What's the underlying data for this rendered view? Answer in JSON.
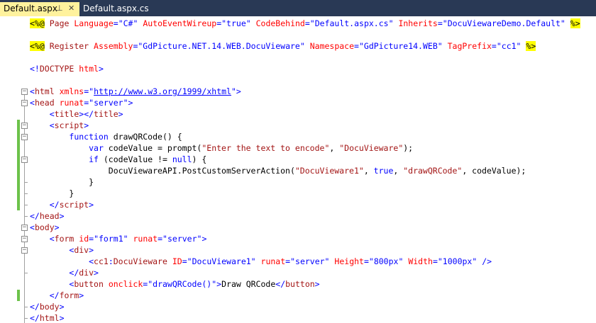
{
  "tabs": [
    {
      "label": "Default.aspx",
      "active": true,
      "pin_icon": "pin-icon",
      "close_icon": "close-icon"
    },
    {
      "label": "Default.aspx.cs",
      "active": false
    }
  ],
  "code_lines": [
    [
      [
        "dir",
        "<%@"
      ],
      [
        "black",
        " "
      ],
      [
        "maroon",
        "Page"
      ],
      [
        "black",
        " "
      ],
      [
        "red",
        "Language"
      ],
      [
        "blue",
        "="
      ],
      [
        "str",
        "\"C#\""
      ],
      [
        "black",
        " "
      ],
      [
        "red",
        "AutoEventWireup"
      ],
      [
        "blue",
        "="
      ],
      [
        "str",
        "\"true\""
      ],
      [
        "black",
        " "
      ],
      [
        "red",
        "CodeBehind"
      ],
      [
        "blue",
        "="
      ],
      [
        "str",
        "\"Default.aspx.cs\""
      ],
      [
        "black",
        " "
      ],
      [
        "red",
        "Inherits"
      ],
      [
        "blue",
        "="
      ],
      [
        "str",
        "\"DocuViewareDemo.Default\""
      ],
      [
        "black",
        " "
      ],
      [
        "dir",
        "%>"
      ]
    ],
    [],
    [
      [
        "dir",
        "<%@"
      ],
      [
        "black",
        " "
      ],
      [
        "maroon",
        "Register"
      ],
      [
        "black",
        " "
      ],
      [
        "red",
        "Assembly"
      ],
      [
        "blue",
        "="
      ],
      [
        "str",
        "\"GdPicture.NET.14.WEB.DocuVieware\""
      ],
      [
        "black",
        " "
      ],
      [
        "red",
        "Namespace"
      ],
      [
        "blue",
        "="
      ],
      [
        "str",
        "\"GdPicture14.WEB\""
      ],
      [
        "black",
        " "
      ],
      [
        "red",
        "TagPrefix"
      ],
      [
        "blue",
        "="
      ],
      [
        "str",
        "\"cc1\""
      ],
      [
        "black",
        " "
      ],
      [
        "dir",
        "%>"
      ]
    ],
    [],
    [
      [
        "blue",
        "<!"
      ],
      [
        "maroon",
        "DOCTYPE"
      ],
      [
        "black",
        " "
      ],
      [
        "red",
        "html"
      ],
      [
        "blue",
        ">"
      ]
    ],
    [],
    [
      [
        "blue",
        "<"
      ],
      [
        "maroon",
        "html"
      ],
      [
        "black",
        " "
      ],
      [
        "red",
        "xmlns"
      ],
      [
        "blue",
        "="
      ],
      [
        "blue",
        "\""
      ],
      [
        "link",
        "http://www.w3.org/1999/xhtml"
      ],
      [
        "blue",
        "\">"
      ]
    ],
    [
      [
        "blue",
        "<"
      ],
      [
        "maroon",
        "head"
      ],
      [
        "black",
        " "
      ],
      [
        "red",
        "runat"
      ],
      [
        "blue",
        "="
      ],
      [
        "str",
        "\"server\""
      ],
      [
        "blue",
        ">"
      ]
    ],
    [
      [
        "black",
        "    "
      ],
      [
        "blue",
        "<"
      ],
      [
        "maroon",
        "title"
      ],
      [
        "blue",
        "></"
      ],
      [
        "maroon",
        "title"
      ],
      [
        "blue",
        ">"
      ]
    ],
    [
      [
        "black",
        "    "
      ],
      [
        "blue",
        "<"
      ],
      [
        "maroon",
        "script"
      ],
      [
        "blue",
        ">"
      ]
    ],
    [
      [
        "black",
        "        "
      ],
      [
        "kw",
        "function"
      ],
      [
        "black",
        " drawQRCode() {"
      ]
    ],
    [
      [
        "black",
        "            "
      ],
      [
        "kw",
        "var"
      ],
      [
        "black",
        " codeValue = prompt("
      ],
      [
        "jsstr",
        "\"Enter the text to encode\""
      ],
      [
        "black",
        ", "
      ],
      [
        "jsstr",
        "\"DocuVieware\""
      ],
      [
        "black",
        ");"
      ]
    ],
    [
      [
        "black",
        "            "
      ],
      [
        "kw",
        "if"
      ],
      [
        "black",
        " (codeValue != "
      ],
      [
        "kw",
        "null"
      ],
      [
        "black",
        ") {"
      ]
    ],
    [
      [
        "black",
        "                DocuViewareAPI.PostCustomServerAction("
      ],
      [
        "jsstr",
        "\"DocuVieware1\""
      ],
      [
        "black",
        ", "
      ],
      [
        "kw",
        "true"
      ],
      [
        "black",
        ", "
      ],
      [
        "jsstr",
        "\"drawQRCode\""
      ],
      [
        "black",
        ", codeValue);"
      ]
    ],
    [
      [
        "black",
        "            }"
      ]
    ],
    [
      [
        "black",
        "        }"
      ]
    ],
    [
      [
        "black",
        "    "
      ],
      [
        "blue",
        "</"
      ],
      [
        "maroon",
        "script"
      ],
      [
        "blue",
        ">"
      ]
    ],
    [
      [
        "blue",
        "</"
      ],
      [
        "maroon",
        "head"
      ],
      [
        "blue",
        ">"
      ]
    ],
    [
      [
        "blue",
        "<"
      ],
      [
        "maroon",
        "body"
      ],
      [
        "blue",
        ">"
      ]
    ],
    [
      [
        "black",
        "    "
      ],
      [
        "blue",
        "<"
      ],
      [
        "maroon",
        "form"
      ],
      [
        "black",
        " "
      ],
      [
        "red",
        "id"
      ],
      [
        "blue",
        "="
      ],
      [
        "str",
        "\"form1\""
      ],
      [
        "black",
        " "
      ],
      [
        "red",
        "runat"
      ],
      [
        "blue",
        "="
      ],
      [
        "str",
        "\"server\""
      ],
      [
        "blue",
        ">"
      ]
    ],
    [
      [
        "black",
        "        "
      ],
      [
        "blue",
        "<"
      ],
      [
        "maroon",
        "div"
      ],
      [
        "blue",
        ">"
      ]
    ],
    [
      [
        "black",
        "            "
      ],
      [
        "blue",
        "<"
      ],
      [
        "maroon",
        "cc1"
      ],
      [
        "blue",
        ":"
      ],
      [
        "maroon",
        "DocuVieware"
      ],
      [
        "black",
        " "
      ],
      [
        "red",
        "ID"
      ],
      [
        "blue",
        "="
      ],
      [
        "str",
        "\"DocuVieware1\""
      ],
      [
        "black",
        " "
      ],
      [
        "red",
        "runat"
      ],
      [
        "blue",
        "="
      ],
      [
        "str",
        "\"server\""
      ],
      [
        "black",
        " "
      ],
      [
        "red",
        "Height"
      ],
      [
        "blue",
        "="
      ],
      [
        "str",
        "\"800px\""
      ],
      [
        "black",
        " "
      ],
      [
        "red",
        "Width"
      ],
      [
        "blue",
        "="
      ],
      [
        "str",
        "\"1000px\""
      ],
      [
        "black",
        " "
      ],
      [
        "blue",
        "/>"
      ]
    ],
    [
      [
        "black",
        "        "
      ],
      [
        "blue",
        "</"
      ],
      [
        "maroon",
        "div"
      ],
      [
        "blue",
        ">"
      ]
    ],
    [
      [
        "black",
        "        "
      ],
      [
        "blue",
        "<"
      ],
      [
        "maroon",
        "button"
      ],
      [
        "black",
        " "
      ],
      [
        "red",
        "onclick"
      ],
      [
        "blue",
        "="
      ],
      [
        "str",
        "\"drawQRCode()\""
      ],
      [
        "blue",
        ">"
      ],
      [
        "black",
        "Draw QRCode"
      ],
      [
        "blue",
        "</"
      ],
      [
        "maroon",
        "button"
      ],
      [
        "blue",
        ">"
      ]
    ],
    [
      [
        "black",
        "    "
      ],
      [
        "blue",
        "</"
      ],
      [
        "maroon",
        "form"
      ],
      [
        "blue",
        ">"
      ]
    ],
    [
      [
        "blue",
        "</"
      ],
      [
        "maroon",
        "body"
      ],
      [
        "blue",
        ">"
      ]
    ],
    [
      [
        "blue",
        "</"
      ],
      [
        "maroon",
        "html"
      ],
      [
        "blue",
        ">"
      ]
    ]
  ]
}
